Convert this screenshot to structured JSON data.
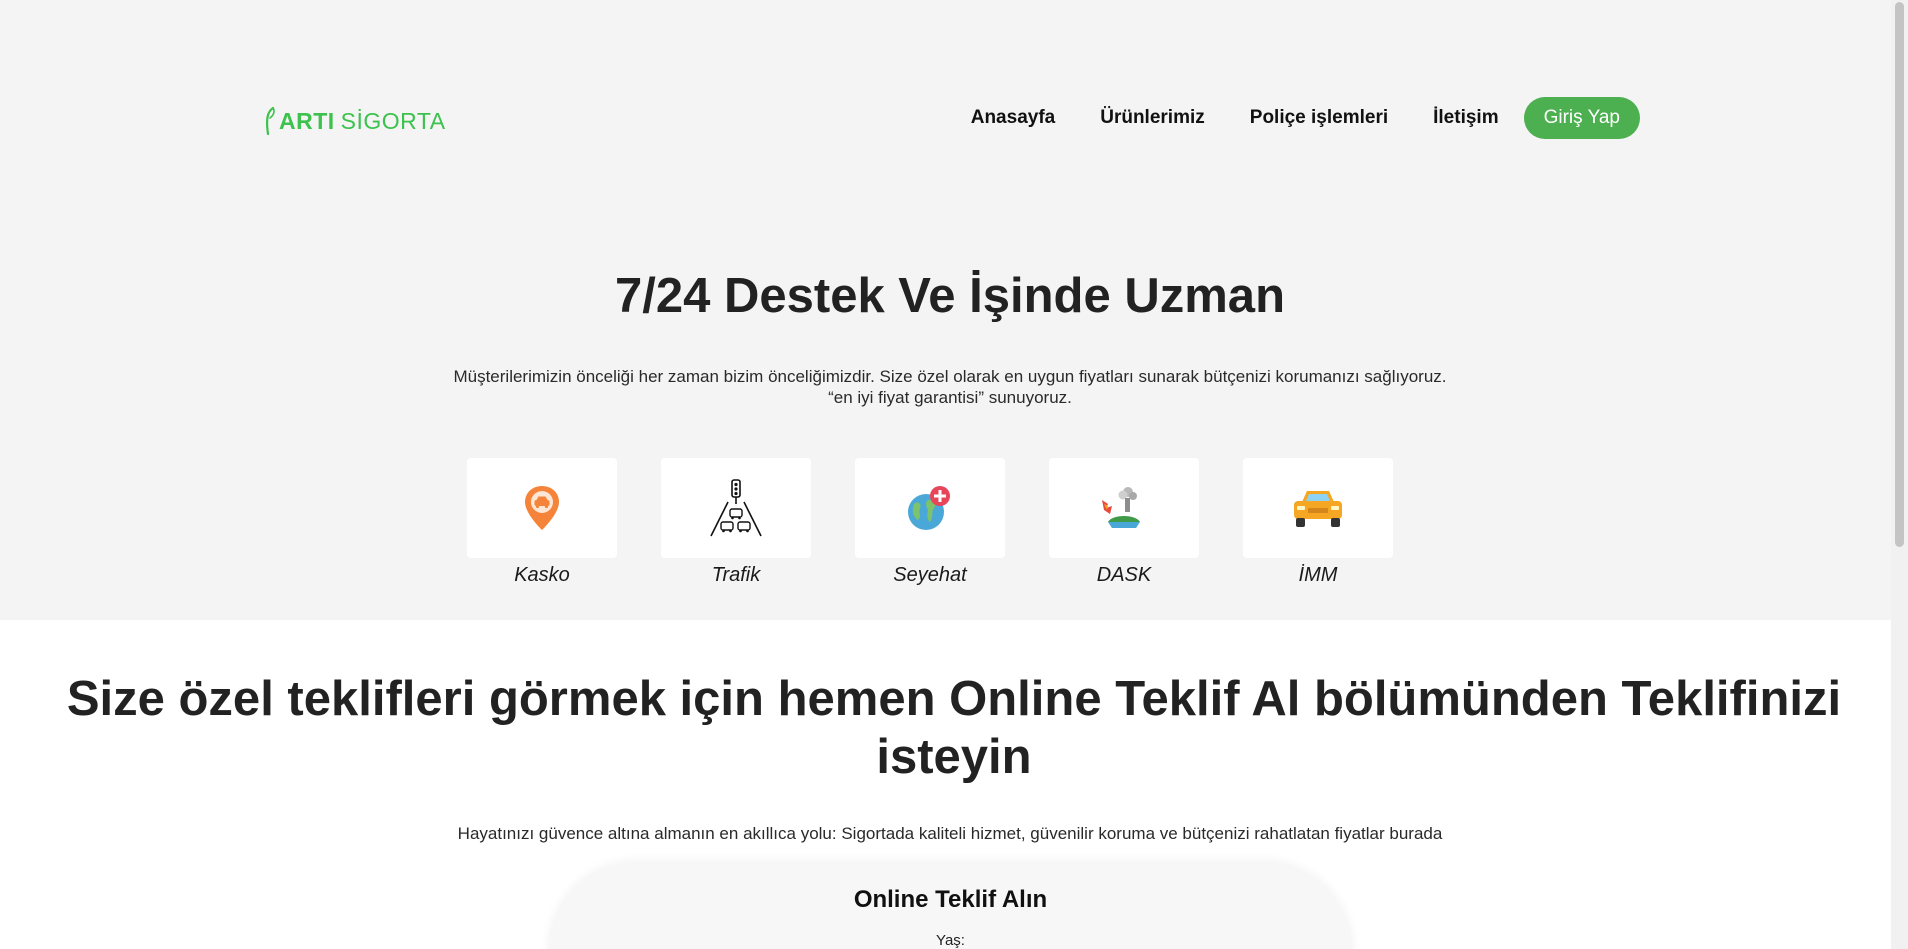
{
  "logo": {
    "bold_text": "ARTI",
    "light_text": "SİGORTA"
  },
  "nav": {
    "items": [
      {
        "label": "Anasayfa"
      },
      {
        "label": "Ürünlerimiz"
      },
      {
        "label": "Poliçe işlemleri"
      },
      {
        "label": "İletişim"
      }
    ],
    "login_label": "Giriş Yap"
  },
  "hero": {
    "title": "7/24 Destek Ve İşinde Uzman",
    "desc_line1": "Müşterilerimizin önceliği her zaman bizim önceliğimizdir. Size özel olarak en uygun fiyatları sunarak bütçenizi korumanızı sağlıyoruz.",
    "desc_line2": "“en iyi fiyat garantisi” sunuyoruz."
  },
  "products": [
    {
      "label": "Kasko",
      "icon": "car-location-pin-icon"
    },
    {
      "label": "Trafik",
      "icon": "traffic-light-road-icon"
    },
    {
      "label": "Seyehat",
      "icon": "globe-health-icon"
    },
    {
      "label": "DASK",
      "icon": "earthquake-icon"
    },
    {
      "label": "İMM",
      "icon": "orange-car-icon"
    }
  ],
  "offer": {
    "title": "Size özel teklifleri görmek için hemen Online Teklif Al bölümünden Teklifinizi isteyin",
    "subtitle": "Hayatınızı güvence altına almanın en akıllıca yolu: Sigortada kaliteli hizmet, güvenilir koruma ve bütçenizi rahatlatan fiyatlar burada",
    "form_title": "Online Teklif Alın",
    "age_label": "Yaş:"
  },
  "colors": {
    "brand_green": "#3cc24d",
    "button_green": "#4caf50",
    "hero_bg": "#f4f4f5"
  }
}
